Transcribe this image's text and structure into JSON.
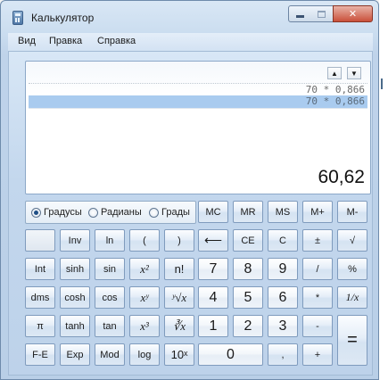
{
  "window": {
    "title": "Калькулятор",
    "close_label": "✕"
  },
  "menu": [
    "Вид",
    "Правка",
    "Справка"
  ],
  "display": {
    "history_up": "▲",
    "history_down": "▼",
    "history": [
      "70 * 0,866",
      "70 * 0,866"
    ],
    "result": "60,62"
  },
  "angle_units": {
    "options": [
      "Градусы",
      "Радианы",
      "Грады"
    ],
    "selected": "Градусы"
  },
  "buttons": {
    "mc": "MC",
    "mr": "MR",
    "ms": "MS",
    "mplus": "M+",
    "mminus": "M-",
    "inv": "Inv",
    "ln": "ln",
    "lparen": "(",
    "rparen": ")",
    "backspace": "⟵",
    "ce": "CE",
    "c": "C",
    "plusminus": "±",
    "sqrt": "√",
    "int": "Int",
    "sinh": "sinh",
    "sin": "sin",
    "sq": "x²",
    "fact": "n!",
    "d7": "7",
    "d8": "8",
    "d9": "9",
    "div": "/",
    "pct": "%",
    "dms": "dms",
    "cosh": "cosh",
    "cos": "cos",
    "pow": "xʸ",
    "yroot": "ʸ√x",
    "d4": "4",
    "d5": "5",
    "d6": "6",
    "mul": "*",
    "recip": "1/x",
    "pi": "π",
    "tanh": "tanh",
    "tan": "tan",
    "cube": "x³",
    "cbrt": "∛x",
    "d1": "1",
    "d2": "2",
    "d3": "3",
    "sub": "-",
    "eq": "=",
    "fe": "F-E",
    "exp": "Exp",
    "mod": "Mod",
    "log": "log",
    "tenx": "10ˣ",
    "d0": "0",
    "dot": ",",
    "add": "+"
  }
}
